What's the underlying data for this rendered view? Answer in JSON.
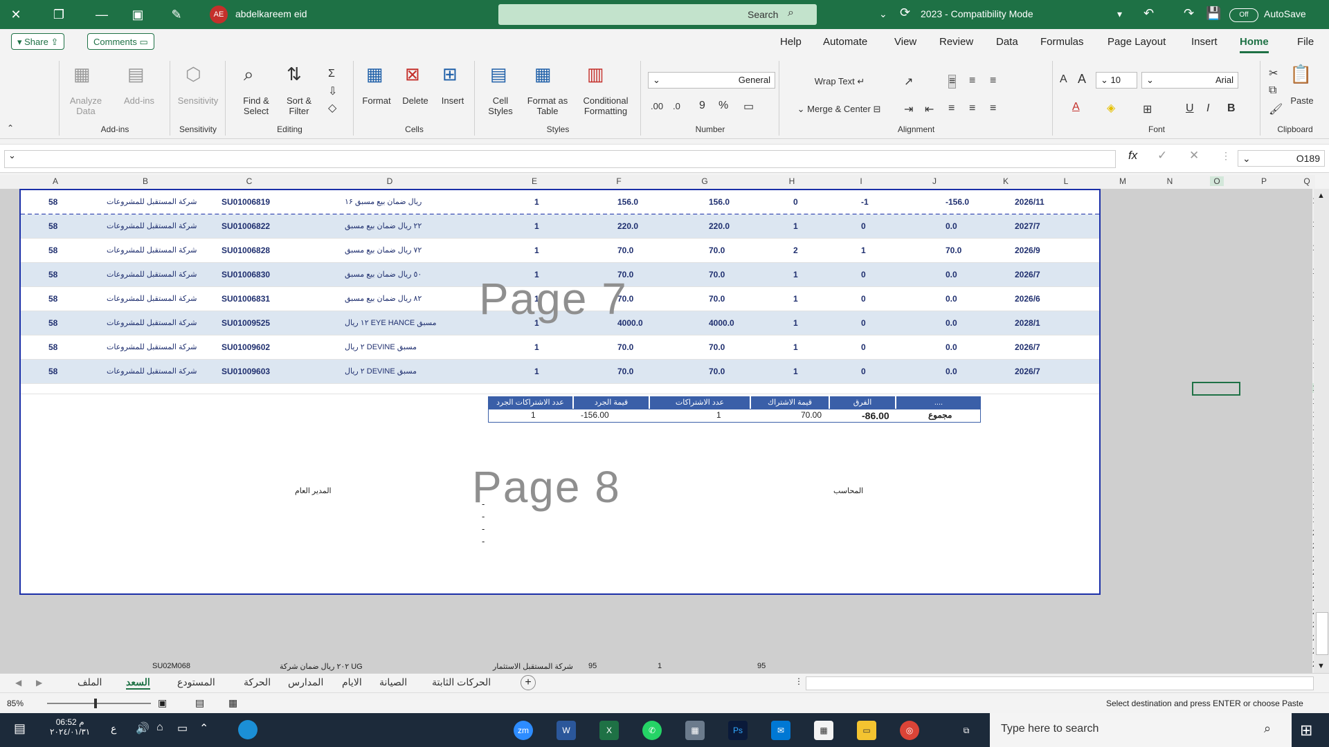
{
  "window": {
    "title": "2023 - Compatibility Mode",
    "autosave_label": "AutoSave",
    "autosave_state": "Off",
    "search_placeholder": "Search",
    "user_name": "abdelkareem eid",
    "user_initials": "AE"
  },
  "ribbon_tabs": [
    "File",
    "Home",
    "Insert",
    "Page Layout",
    "Formulas",
    "Data",
    "Review",
    "View",
    "Automate",
    "Help"
  ],
  "active_tab": "Home",
  "top_buttons": {
    "comments": "Comments",
    "share": "Share"
  },
  "ribbon": {
    "clipboard": {
      "label": "Clipboard",
      "paste": "Paste"
    },
    "font": {
      "label": "Font",
      "name": "Arial",
      "size": "10",
      "bold": "B",
      "italic": "I",
      "underline": "U"
    },
    "alignment": {
      "label": "Alignment",
      "wrap": "Wrap Text",
      "merge": "Merge & Center"
    },
    "number": {
      "label": "Number",
      "format": "General"
    },
    "styles": {
      "label": "Styles",
      "conditional": "Conditional Formatting",
      "table": "Format as Table",
      "cell": "Cell Styles"
    },
    "cells": {
      "label": "Cells",
      "insert": "Insert",
      "delete": "Delete",
      "format": "Format"
    },
    "editing": {
      "label": "Editing",
      "sort": "Sort & Filter",
      "find": "Find & Select"
    },
    "sensitivity": {
      "label": "Sensitivity",
      "btn": "Sensitivity"
    },
    "addins": {
      "label": "Add-ins",
      "btn": "Add-ins",
      "analyze": "Analyze Data"
    }
  },
  "formula_bar": {
    "name_box": "O189",
    "fx": "fx",
    "content": ""
  },
  "columns": [
    "A",
    "B",
    "C",
    "D",
    "E",
    "F",
    "G",
    "H",
    "I",
    "J",
    "K",
    "L",
    "M",
    "N",
    "O",
    "P",
    "Q"
  ],
  "row_numbers": [
    "181",
    "182",
    "183",
    "184",
    "185",
    "186",
    "187",
    "188",
    "189",
    "190",
    "191",
    "192",
    "193",
    "194",
    "195",
    "196",
    "197",
    "198",
    "199",
    "200",
    "201",
    "202",
    "203",
    "204",
    "205",
    "206",
    "207",
    "208",
    "209",
    "210"
  ],
  "rows": [
    {
      "k": "2026/11",
      "j": "-156.0",
      "i": "-1",
      "h": "0",
      "g": "156.0",
      "f": "156.0",
      "e": "1",
      "d": "١۶ ريال ضمان بيع مسبق",
      "c": "SU01006819",
      "b": "شركة المستقبل للمشروعات",
      "a": "58"
    },
    {
      "k": "2027/7",
      "j": "0.0",
      "i": "0",
      "h": "1",
      "g": "220.0",
      "f": "220.0",
      "e": "1",
      "d": "٢٢ ريال ضمان بيع مسبق",
      "c": "SU01006822",
      "b": "شركة المستقبل للمشروعات",
      "a": "58"
    },
    {
      "k": "2026/9",
      "j": "70.0",
      "i": "1",
      "h": "2",
      "g": "70.0",
      "f": "70.0",
      "e": "1",
      "d": "٧٢ ريال ضمان بيع مسبق",
      "c": "SU01006828",
      "b": "شركة المستقبل للمشروعات",
      "a": "58"
    },
    {
      "k": "2026/7",
      "j": "0.0",
      "i": "0",
      "h": "1",
      "g": "70.0",
      "f": "70.0",
      "e": "1",
      "d": "٥٠ ريال ضمان بيع مسبق",
      "c": "SU01006830",
      "b": "شركة المستقبل للمشروعات",
      "a": "58"
    },
    {
      "k": "2026/6",
      "j": "0.0",
      "i": "0",
      "h": "1",
      "g": "70.0",
      "f": "70.0",
      "e": "1",
      "d": "٨٢ ريال ضمان بيع مسبق",
      "c": "SU01006831",
      "b": "شركة المستقبل للمشروعات",
      "a": "58"
    },
    {
      "k": "2028/1",
      "j": "0.0",
      "i": "0",
      "h": "1",
      "g": "4000.0",
      "f": "4000.0",
      "e": "1",
      "d": "١٢ ريال EYE HANCE مسبق",
      "c": "SU01009525",
      "b": "شركة المستقبل للمشروعات",
      "a": "58"
    },
    {
      "k": "2026/7",
      "j": "0.0",
      "i": "0",
      "h": "1",
      "g": "70.0",
      "f": "70.0",
      "e": "1",
      "d": "٢ ريال DEVINE مسبق",
      "c": "SU01009602",
      "b": "شركة المستقبل للمشروعات",
      "a": "58"
    },
    {
      "k": "2026/7",
      "j": "0.0",
      "i": "0",
      "h": "1",
      "g": "70.0",
      "f": "70.0",
      "e": "1",
      "d": "٢ ريال DEVINE مسبق",
      "c": "SU01009603",
      "b": "شركة المستقبل للمشروعات",
      "a": "58"
    }
  ],
  "page_labels": {
    "page7": "Page 7",
    "page8": "Page 8"
  },
  "summary_table": {
    "headers": [
      "....",
      "الفرق",
      "قيمة الاشتراك",
      "عدد الاشتراكات",
      "قيمة الجرد",
      "عدد الاشتراكات الجرد"
    ],
    "values": [
      "مجموع",
      "-86.00",
      "70.00",
      "1",
      "-156.00",
      "1"
    ]
  },
  "footer_text": {
    "left": "المدير العام",
    "right": "المحاسب",
    "dashes": [
      "-",
      "-",
      "-",
      "-"
    ]
  },
  "bottom_row": {
    "a": "SU02M068",
    "c": "٢٠٢ ريال ضمان شركة UG",
    "d": "شركة المستقبل الاستثمار",
    "e": "95",
    "g": "1",
    "i": "95"
  },
  "sheet_tabs": [
    "الملف",
    "السعد",
    "المستودع",
    "الحركة",
    "المدارس",
    "الايام",
    "الصيانة",
    "الحركات الثابتة"
  ],
  "active_sheet": "السعد",
  "status": {
    "message": "Select destination and press ENTER or choose Paste",
    "zoom": "85%"
  },
  "taskbar": {
    "search": "Type here to search",
    "time": "06:52 م",
    "date": "٢٠٢٤/٠١/٣١"
  }
}
